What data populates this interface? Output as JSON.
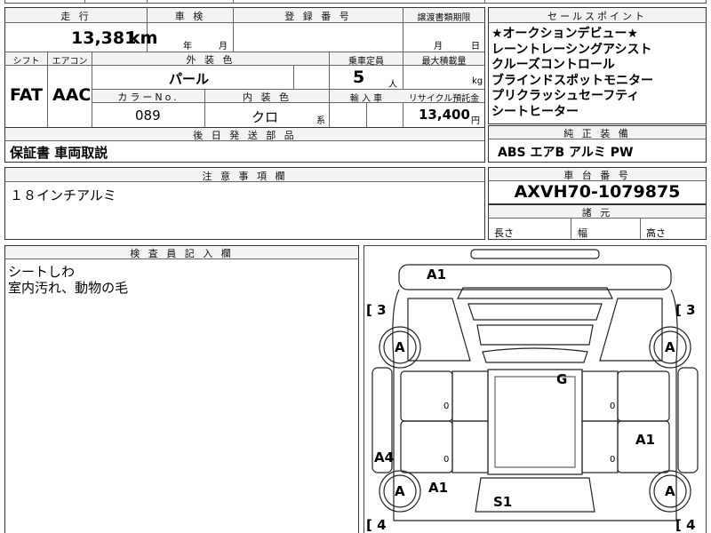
{
  "top_strip": {
    "partial_text": "…"
  },
  "mileage": {
    "label": "走 行",
    "value": "13,381",
    "unit": "km"
  },
  "shaken": {
    "label": "車 検",
    "year": "年",
    "month": "月"
  },
  "registration": {
    "label": "登 録 番 号"
  },
  "transfer_deadline": {
    "label": "譲渡書類期限",
    "month": "月",
    "day": "日"
  },
  "shift": {
    "label": "シフト",
    "value": "FAT"
  },
  "aircon": {
    "label": "エアコン",
    "value": "AAC"
  },
  "exterior_color": {
    "label": "外 装 色",
    "value": "パール"
  },
  "capacity": {
    "label": "乗車定員",
    "value": "5",
    "unit": "人"
  },
  "max_load": {
    "label": "最大積載量",
    "unit": "kg"
  },
  "color_no": {
    "label": "カラーNo.",
    "value": "089"
  },
  "interior_color": {
    "label": "内 装 色",
    "value": "クロ",
    "suffix": "系"
  },
  "import": {
    "label": "輸 入 車"
  },
  "recycle": {
    "label": "リサイクル預託金",
    "value": "13,400",
    "unit": "円"
  },
  "later_parts": {
    "label": "後 日 発 送 部 品",
    "value": "保証書 車両取説"
  },
  "sales_points": {
    "label": "セールスポイント",
    "lines": [
      "★オークションデビュー★",
      "レーントレーシングアシスト",
      "クルーズコントロール",
      "ブラインドスポットモニター",
      "プリクラッシュセーフティ",
      "シートヒーター"
    ]
  },
  "factory_equipment": {
    "label": "純 正 装 備",
    "value": "ABS エアB アルミ PW"
  },
  "caution": {
    "label": "注 意 事 項 欄",
    "value": "１８インチアルミ"
  },
  "chassis_number": {
    "label": "車 台 番 号",
    "value": "AXVH70-1079875"
  },
  "dimensions": {
    "label": "諸 元",
    "length": "長さ",
    "width": "幅",
    "height": "高さ"
  },
  "inspector": {
    "label": "検 査 員 記 入 欄",
    "lines": [
      "シートしわ",
      "室内汚れ、動物の毛"
    ]
  },
  "diagram": {
    "bracket_tl": "[ 3",
    "bracket_tr": "[ 3",
    "bracket_bl": "[ 4",
    "bracket_br": "[ 4",
    "roof_marks": [
      "0",
      "0",
      "0",
      "0"
    ],
    "marks": {
      "front_top": "A1",
      "wheel_fl": "A",
      "wheel_fr": "A",
      "roof": "G",
      "right_door": "A1",
      "left_rear_side": "A4",
      "left_rear_door": "A1",
      "wheel_rl": "A",
      "wheel_rr": "A",
      "rear_center": "S1"
    }
  }
}
